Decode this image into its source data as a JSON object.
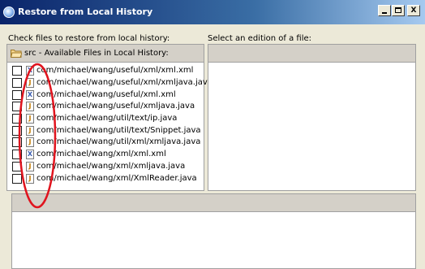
{
  "window": {
    "title": "Restore from Local History",
    "minimize_label": "_",
    "close_label": "X"
  },
  "left_panel": {
    "label": "Check files to restore from local history:",
    "header": "src - Available Files in Local History:",
    "files": [
      {
        "name": "com/michael/wang/useful/xml/xml.xml",
        "icon": "xml-file-icon",
        "type": "xml",
        "checked": false
      },
      {
        "name": "com/michael/wang/useful/xml/xmljava.java",
        "icon": "java-file-icon",
        "type": "java",
        "checked": false
      },
      {
        "name": "com/michael/wang/useful/xml.xml",
        "icon": "xml-file-icon",
        "type": "xml",
        "checked": false
      },
      {
        "name": "com/michael/wang/useful/xmljava.java",
        "icon": "java-file-icon",
        "type": "java",
        "checked": false
      },
      {
        "name": "com/michael/wang/util/text/ip.java",
        "icon": "java-file-icon",
        "type": "java",
        "checked": false
      },
      {
        "name": "com/michael/wang/util/text/Snippet.java",
        "icon": "java-file-icon",
        "type": "java",
        "checked": false
      },
      {
        "name": "com/michael/wang/util/xml/xmljava.java",
        "icon": "java-file-icon",
        "type": "java",
        "checked": false
      },
      {
        "name": "com/michael/wang/xml/xml.xml",
        "icon": "xml-file-icon",
        "type": "xml",
        "checked": false
      },
      {
        "name": "com/michael/wang/xml/xmljava.java",
        "icon": "java-file-icon",
        "type": "java",
        "checked": false
      },
      {
        "name": "com/michael/wang/xml/XmlReader.java",
        "icon": "java-file-icon",
        "type": "java",
        "checked": false
      }
    ]
  },
  "right_panel": {
    "label": "Select an edition of a file:"
  },
  "colors": {
    "annotation": "#e0141e",
    "title_gradient_start": "#0a246a",
    "window_bg": "#ece9d8"
  }
}
